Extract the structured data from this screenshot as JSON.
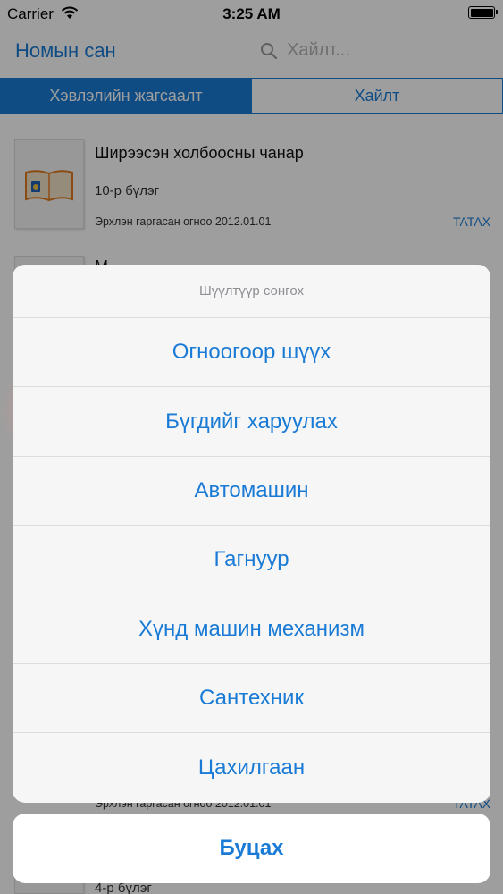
{
  "status_bar": {
    "carrier": "Carrier",
    "time": "3:25 AM"
  },
  "nav": {
    "title": "Номын сан",
    "search_placeholder": "Хайлт..."
  },
  "tabs": [
    {
      "label": "Хэвлэлийн жагсаалт",
      "active": true
    },
    {
      "label": "Хайлт",
      "active": false
    }
  ],
  "list": {
    "items": [
      {
        "title": "Ширээсэн холбоосны чанар",
        "chapter": "10-р бүлэг",
        "date": "Эрхлэн гаргасан огноо 2012.01.01",
        "action": "TATAX"
      },
      {
        "title": "М",
        "chapter": "",
        "date": "",
        "action": ""
      },
      {
        "title": "",
        "chapter": "",
        "date": "Эрхлэн гаргасан огноо 2012.01.01",
        "action": "TATAX"
      },
      {
        "title": "",
        "chapter": "4-р бүлэг",
        "date": "",
        "action": ""
      }
    ]
  },
  "action_sheet": {
    "title": "Шүүлтүүр сонгох",
    "options": [
      "Огноогоор шүүх",
      "Бүгдийг харуулах",
      "Автомашин",
      "Гагнуур",
      "Хүнд машин механизм",
      "Сантехник",
      "Цахилгаан"
    ],
    "cancel_label": "Буцах"
  },
  "colors": {
    "accent": "#1a7bd6",
    "overlay": "rgba(0,0,0,0.38)"
  }
}
